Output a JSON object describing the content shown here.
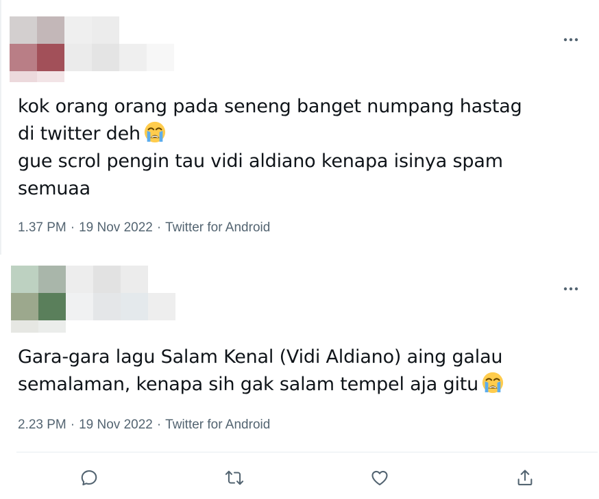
{
  "tweets": [
    {
      "lines": [
        "kok orang orang pada seneng banget numpang hastag",
        "di twitter deh",
        "gue scrol pengin tau vidi aldiano kenapa isinya spam",
        "semuaa"
      ],
      "time": "1.37 PM",
      "date": "19 Nov 2022",
      "source": "Twitter for Android",
      "emoji": "loudly-crying-face"
    },
    {
      "lines": [
        "Gara-gara lagu Salam Kenal (Vidi Aldiano) aing galau",
        "semalaman, kenapa sih gak salam tempel aja gitu"
      ],
      "time": "2.23 PM",
      "date": "19 Nov 2022",
      "source": "Twitter for Android",
      "emoji": "loudly-crying-face"
    }
  ],
  "separator": "·",
  "icons": {
    "more": "more-horizontal-icon",
    "reply": "reply-icon",
    "retweet": "retweet-icon",
    "like": "like-icon",
    "share": "share-icon"
  },
  "colors": {
    "text": "#0f1419",
    "meta": "#536471",
    "border": "#e6ecf0"
  }
}
